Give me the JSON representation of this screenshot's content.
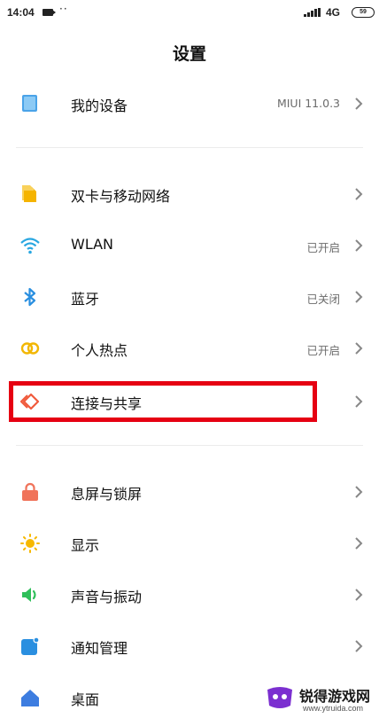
{
  "status_bar": {
    "time": "14:04",
    "dots": "··",
    "network": "4G",
    "battery": "59"
  },
  "header": {
    "title": "设置"
  },
  "sections": [
    {
      "items": [
        {
          "label": "我的设备",
          "value": "MIUI 11.0.3",
          "icon": "device-icon"
        }
      ]
    },
    {
      "items": [
        {
          "label": "双卡与移动网络",
          "value": "",
          "icon": "sim-card-icon"
        },
        {
          "label": "WLAN",
          "value": "已开启",
          "icon": "wifi-icon"
        },
        {
          "label": "蓝牙",
          "value": "已关闭",
          "icon": "bluetooth-icon"
        },
        {
          "label": "个人热点",
          "value": "已开启",
          "icon": "hotspot-icon"
        },
        {
          "label": "连接与共享",
          "value": "",
          "icon": "connection-share-icon",
          "highlighted": true
        }
      ]
    },
    {
      "items": [
        {
          "label": "息屏与锁屏",
          "value": "",
          "icon": "lock-icon"
        },
        {
          "label": "显示",
          "value": "",
          "icon": "display-sun-icon"
        },
        {
          "label": "声音与振动",
          "value": "",
          "icon": "sound-icon"
        },
        {
          "label": "通知管理",
          "value": "",
          "icon": "notification-icon"
        },
        {
          "label": "桌面",
          "value": "",
          "icon": "home-icon"
        }
      ]
    }
  ],
  "watermark": {
    "text": "锐得游戏网",
    "url": "www.ytruida.com"
  },
  "colors": {
    "highlight_border": "#e60012",
    "device": "#4aa3e8",
    "sim": "#f5b400",
    "wifi": "#29a7e1",
    "bluetooth": "#2a8fe0",
    "hotspot": "#f2b705",
    "connection": "#f05a3c",
    "lock": "#f0735a",
    "display": "#f6b800",
    "sound": "#2fbf5a",
    "notification": "#2a8fe0",
    "home": "#3d7de0"
  }
}
